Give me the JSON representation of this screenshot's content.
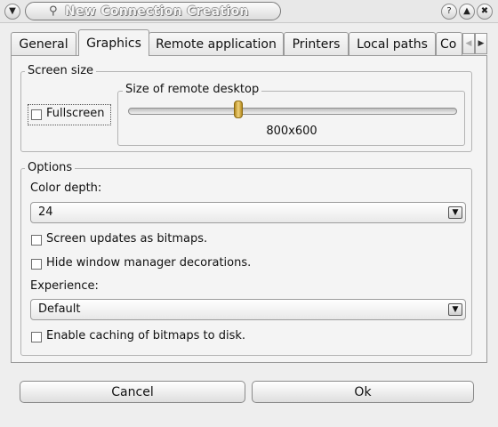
{
  "window": {
    "title": "New Connection Creation",
    "menu_icon": "chevron-down-icon",
    "help_glyph": "?",
    "shade_glyph": "▲",
    "close_glyph": "✖"
  },
  "tabs": [
    {
      "label": "General"
    },
    {
      "label": "Graphics",
      "active": true
    },
    {
      "label": "Remote application"
    },
    {
      "label": "Printers"
    },
    {
      "label": "Local paths"
    },
    {
      "label": "Co"
    }
  ],
  "screen_size": {
    "title": "Screen size",
    "fullscreen_label": "Fullscreen",
    "fullscreen_checked": false,
    "remote_desktop": {
      "title": "Size of remote desktop",
      "value": "800x600",
      "slider_fraction": 0.33
    }
  },
  "options": {
    "title": "Options",
    "color_depth_label": "Color depth:",
    "color_depth_value": "24",
    "bitmaps_label": "Screen updates as bitmaps.",
    "bitmaps_checked": false,
    "wm_label": "Hide window manager decorations.",
    "wm_checked": false,
    "experience_label": "Experience:",
    "experience_value": "Default",
    "caching_label": "Enable caching of bitmaps to disk.",
    "caching_checked": false
  },
  "buttons": {
    "cancel": "Cancel",
    "ok": "Ok"
  }
}
